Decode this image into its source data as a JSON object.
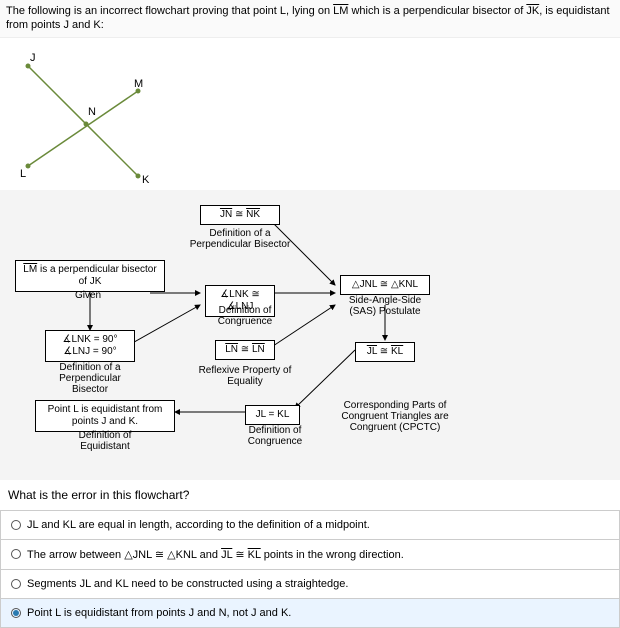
{
  "header": {
    "text_parts": {
      "p1": "The following is an incorrect flowchart proving that point L, lying on ",
      "lm": "LM",
      "p2": " which is a perpendicular bisector of ",
      "jk": "JK",
      "p3": ", is equidistant from points J and K:"
    }
  },
  "diagram": {
    "labels": {
      "J": "J",
      "M": "M",
      "N": "N",
      "L": "L",
      "K": "K"
    }
  },
  "flow": {
    "box_jn_nk": "JN ≅ NK",
    "cap_jn_nk": "Definition of a Perpendicular Bisector",
    "box_lm_perp_pre": "LM",
    "box_lm_perp_post": " is a perpendicular bisector of JK",
    "cap_given": "Given",
    "box_lnk_lnj": "∡LNK ≅ ∡LNJ",
    "cap_lnk_lnj": "Definition of Congruence",
    "box_jnl_knl": "△JNL ≅ △KNL",
    "cap_jnl_knl": "Side-Angle-Side (SAS) Postulate",
    "box_angles90_a": "∡LNK = 90°",
    "box_angles90_b": "∡LNJ = 90°",
    "cap_angles90": "Definition of a Perpendicular Bisector",
    "box_ln_ln": "LN ≅ LN",
    "cap_ln_ln": "Reflexive Property of Equality",
    "box_jl_kl_top": "JL ≅ KL",
    "box_jl_kl_mid": "JL = KL",
    "cap_jl_kl_mid": "Definition of Congruence",
    "cap_cpctc": "Corresponding Parts of Congruent Triangles are Congruent (CPCTC)",
    "box_equidist": "Point L is equidistant from points J and K.",
    "cap_equidist": "Definition of Equidistant"
  },
  "question": "What is the error in this flowchart?",
  "options": {
    "o1_pre": "JL and KL are equal in length, according to the definition of a midpoint.",
    "o2_pre": "The arrow between △JNL ≅ △KNL and ",
    "o2_jl": "JL",
    "o2_mid": " ≅ ",
    "o2_kl": "KL",
    "o2_post": " points in the wrong direction.",
    "o3": "Segments JL and KL need to be constructed using a straightedge.",
    "o4": "Point L is equidistant from points J and N, not J and K."
  }
}
